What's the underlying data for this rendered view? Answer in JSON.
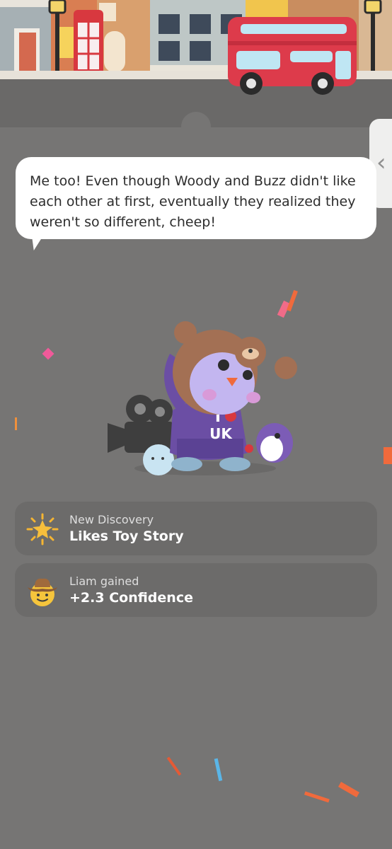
{
  "chat": {
    "message": "Me too! Even though Woody and Buzz didn't like each other at first, eventually they realized they weren't so different, cheep!"
  },
  "side_handle": {
    "icon": "chevron-left-icon",
    "glyph": "‹"
  },
  "cards": [
    {
      "icon": "sun-star-icon",
      "subtitle": "New Discovery",
      "title": "Likes Toy Story"
    },
    {
      "icon": "cowboy-face-icon",
      "subtitle": "Liam gained",
      "title": "+2.3 Confidence"
    }
  ],
  "mascot": {
    "shirt_text_top": "I",
    "shirt_text_bottom": "UK"
  },
  "colors": {
    "background": "#767574",
    "card": "#6c6b6a",
    "bubble": "#ffffff",
    "bus": "#dd3b4b"
  }
}
